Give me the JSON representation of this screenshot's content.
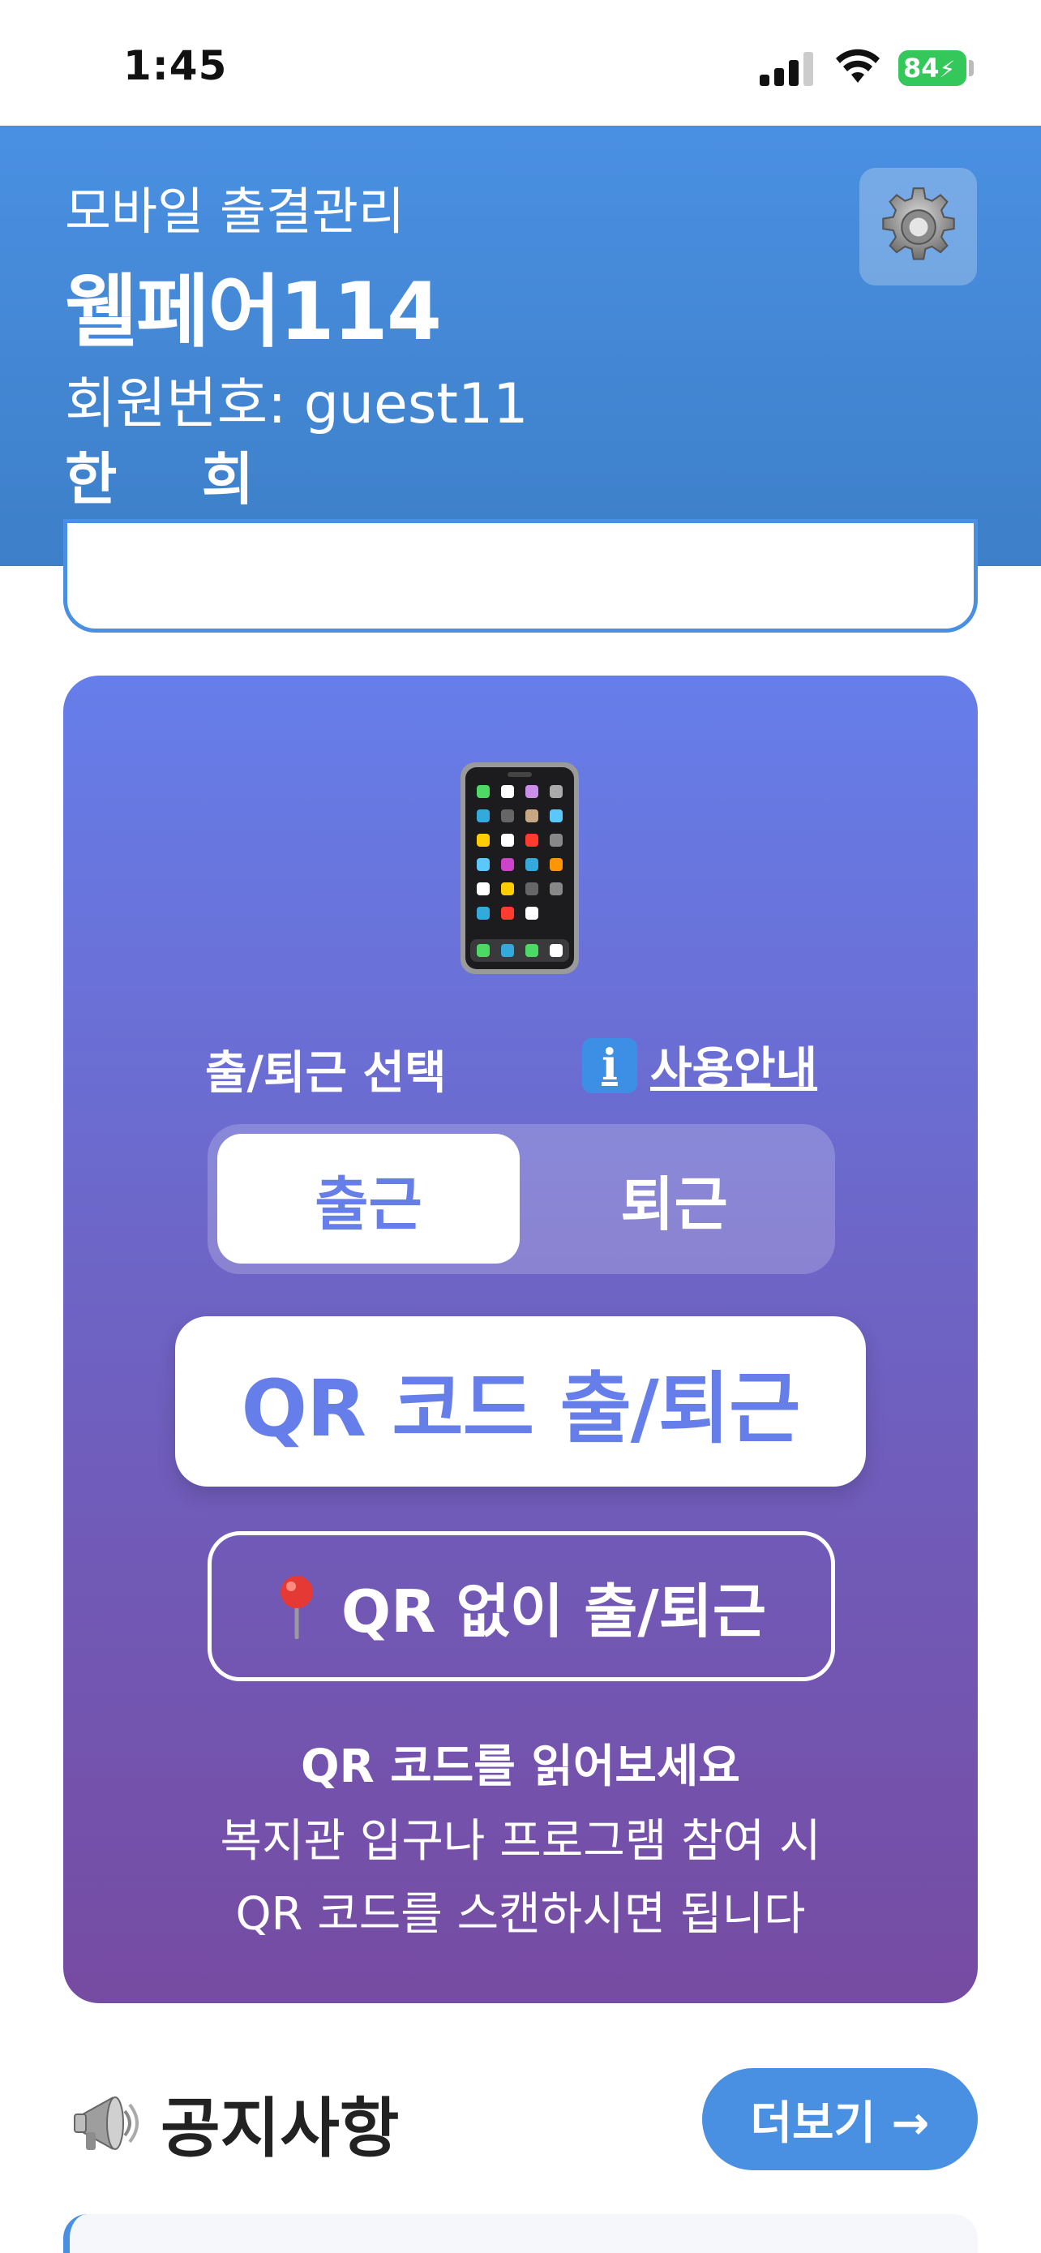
{
  "status_bar": {
    "time": "1:45",
    "battery": "84"
  },
  "header": {
    "subtitle": "모바일 출결관리",
    "title": "웰페어114",
    "member_label": "회원번호: guest11",
    "user_name": "한 희",
    "settings_icon": "gear-icon"
  },
  "checkin_card": {
    "icon": "mobile-phone-icon",
    "mode_label": "출/퇴근 선택",
    "guide_link": "사용안내",
    "toggle": {
      "options": [
        "출근",
        "퇴근"
      ],
      "selected": "출근"
    },
    "qr_button": "QR 코드 출/퇴근",
    "no_qr_button": "QR 없이 출/퇴근",
    "help_title": "QR 코드를 읽어보세요",
    "help_lines": [
      "복지관 입구나 프로그램 참여 시",
      "QR 코드를 스캔하시면 됩니다"
    ]
  },
  "notices": {
    "title": "공지사항",
    "more_button": "더보기 →"
  },
  "colors": {
    "header_blue": "#4a90e2",
    "card_gradient_top": "#667eea",
    "card_gradient_bottom": "#764ba2"
  }
}
